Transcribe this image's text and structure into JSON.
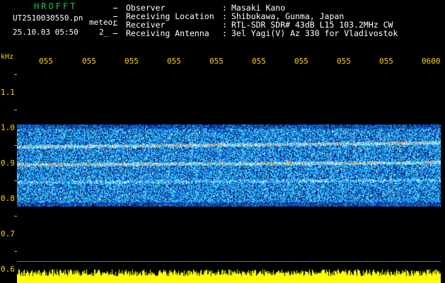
{
  "header": {
    "app_title": "HROFFT",
    "file_name": "UT2510030550.pn",
    "mode": "meteor",
    "date_time": "25.10.03 05:50",
    "count": "2_"
  },
  "info": [
    {
      "label": "Observer",
      "value": "Masaki Kano"
    },
    {
      "label": "Receiving Location",
      "value": "Shibukawa, Gunma, Japan"
    },
    {
      "label": "Receiver",
      "value": "RTL-SDR SDR# 43dB L15 103.2MHz CW"
    },
    {
      "label": "Receiving Antenna",
      "value": "3el Yagi(V) Az 330 for Vladivostok"
    }
  ],
  "axes": {
    "y_unit": "kHz",
    "y_labels": [
      "1.1",
      "1.0",
      "0.9",
      "0.8",
      "0.7",
      "0.6"
    ],
    "x_ticks": [
      "055",
      "055",
      "055",
      "055",
      "055",
      "055",
      "055",
      "055",
      "055",
      "0600"
    ]
  },
  "spectrum": {
    "band_top_khz": 1.0,
    "band_bottom_khz": 0.79,
    "trace_1_khz": 0.945,
    "trace_2_khz": 0.895,
    "trace_3_khz": 0.845,
    "colors": {
      "background": "#000000",
      "low": "#0a1c8c",
      "mid": "#2f9bff",
      "high": "#ffffff",
      "trace": "#ff6a00",
      "amplitude": "#ffff00"
    }
  }
}
